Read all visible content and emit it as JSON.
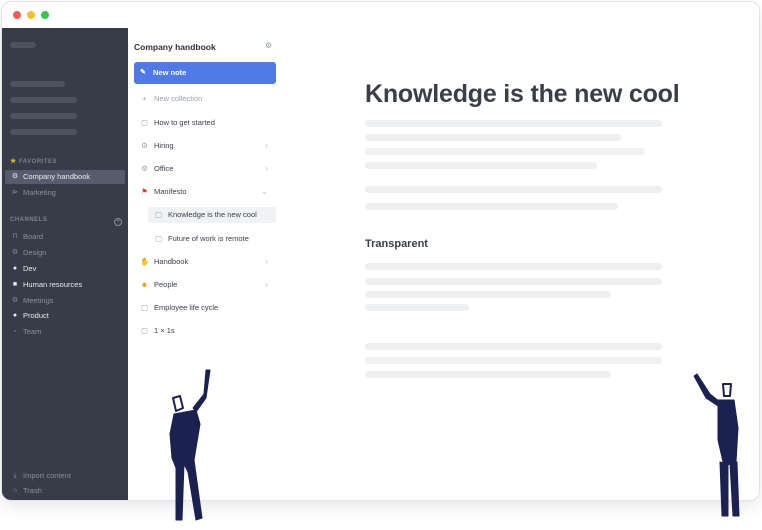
{
  "window": {
    "controls": [
      "close",
      "minimize",
      "zoom"
    ]
  },
  "sidebar": {
    "favorites_heading": "FAVORITES",
    "favorites": [
      {
        "label": "Company handbook",
        "icon": "gear-icon",
        "active": true
      },
      {
        "label": "Marketing",
        "icon": "share-icon"
      }
    ],
    "channels_heading": "CHANNELS",
    "channels": [
      {
        "label": "Board",
        "icon": "lock-icon",
        "bright": false
      },
      {
        "label": "Design",
        "icon": "gear-icon",
        "bright": false
      },
      {
        "label": "Dev",
        "icon": "dot-icon",
        "bright": true
      },
      {
        "label": "Human resources",
        "icon": "lock-icon",
        "bright": true
      },
      {
        "label": "Meetings",
        "icon": "gear-icon",
        "bright": false
      },
      {
        "label": "Product",
        "icon": "dot-icon",
        "bright": true
      },
      {
        "label": "Team",
        "icon": "box-icon",
        "bright": false
      }
    ],
    "footer": [
      {
        "label": "Import content",
        "icon": "download-icon"
      },
      {
        "label": "Trash",
        "icon": "trash-icon"
      }
    ]
  },
  "panel": {
    "title": "Company handbook",
    "new_note": "New note",
    "new_collection": "New collection",
    "items": [
      {
        "label": "How to get started",
        "icon": "document-icon"
      },
      {
        "label": "Hiring",
        "icon": "gear-icon",
        "chevron": "right"
      },
      {
        "label": "Office",
        "icon": "gear-icon",
        "chevron": "right"
      },
      {
        "label": "Manifesto",
        "icon": "flag-icon",
        "chevron": "down"
      },
      {
        "label": "Knowledge is the new cool",
        "icon": "document-icon",
        "sub": true,
        "selected": true
      },
      {
        "label": "Future of work is remote",
        "icon": "document-icon",
        "sub": true
      },
      {
        "label": "Handbook",
        "icon": "handshake-icon",
        "chevron": "right"
      },
      {
        "label": "People",
        "icon": "people-icon",
        "chevron": "right"
      },
      {
        "label": "Employee life cycle",
        "icon": "document-icon"
      },
      {
        "label": "1 × 1s",
        "icon": "document-icon"
      }
    ]
  },
  "document": {
    "title": "Knowledge is the new cool",
    "section_heading": "Transparent"
  },
  "colors": {
    "sidebar_bg": "#373c48",
    "accent": "#4f7ae8",
    "figure": "#1b2150"
  }
}
